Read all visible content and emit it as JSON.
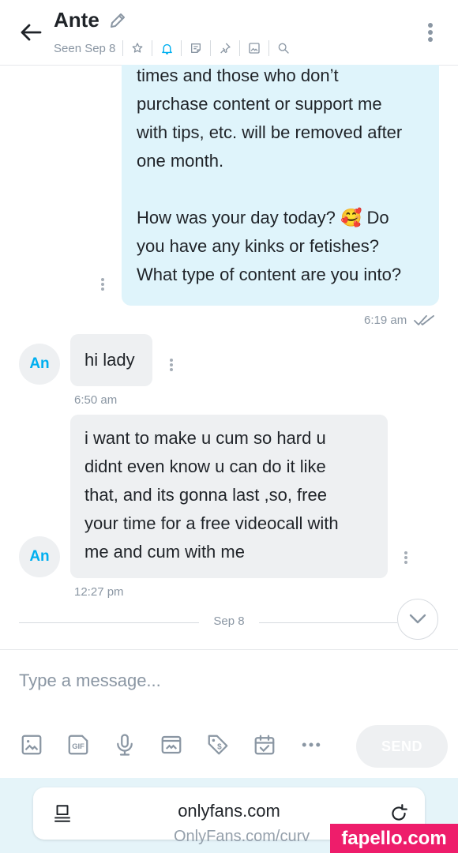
{
  "header": {
    "name": "Ante",
    "seen": "Seen Sep 8",
    "icons": [
      "star-icon",
      "bell-icon",
      "note-icon",
      "pin-icon",
      "image-icon",
      "search-icon"
    ]
  },
  "messages": {
    "outgoing_text": "times and those who don’t\npurchase content or support me\nwith tips, etc. will be removed after\none month.\n\nHow was your day today? 🥰 Do\nyou have any kinks or fetishes?\nWhat type of content are you into?",
    "outgoing_time": "6:19 am",
    "incoming": [
      {
        "avatar": "An",
        "text": "hi lady",
        "time": "6:50 am"
      },
      {
        "avatar": "An",
        "text": "i want to make u cum so hard u\ndidnt even know u can do it like\nthat, and its gonna last ,so, free\nyour time for a free videocall with\nme and cum with me",
        "time": "12:27 pm"
      }
    ],
    "date_separator": "Sep 8"
  },
  "composer": {
    "placeholder": "Type a message...",
    "send_label": "SEND",
    "tools": [
      "image-icon",
      "gif-icon",
      "microphone-icon",
      "vault-icon",
      "price-tag-icon",
      "calendar-icon",
      "more-icon"
    ]
  },
  "browser": {
    "url": "onlyfans.com",
    "watermark": "OnlyFans.com/curv",
    "badge": "fapello.com"
  },
  "colors": {
    "accent": "#00aff0",
    "outgoing_bubble": "#dff4fb",
    "incoming_bubble": "#eef0f2",
    "muted": "#8a96a3",
    "badge": "#ee1d6b"
  }
}
